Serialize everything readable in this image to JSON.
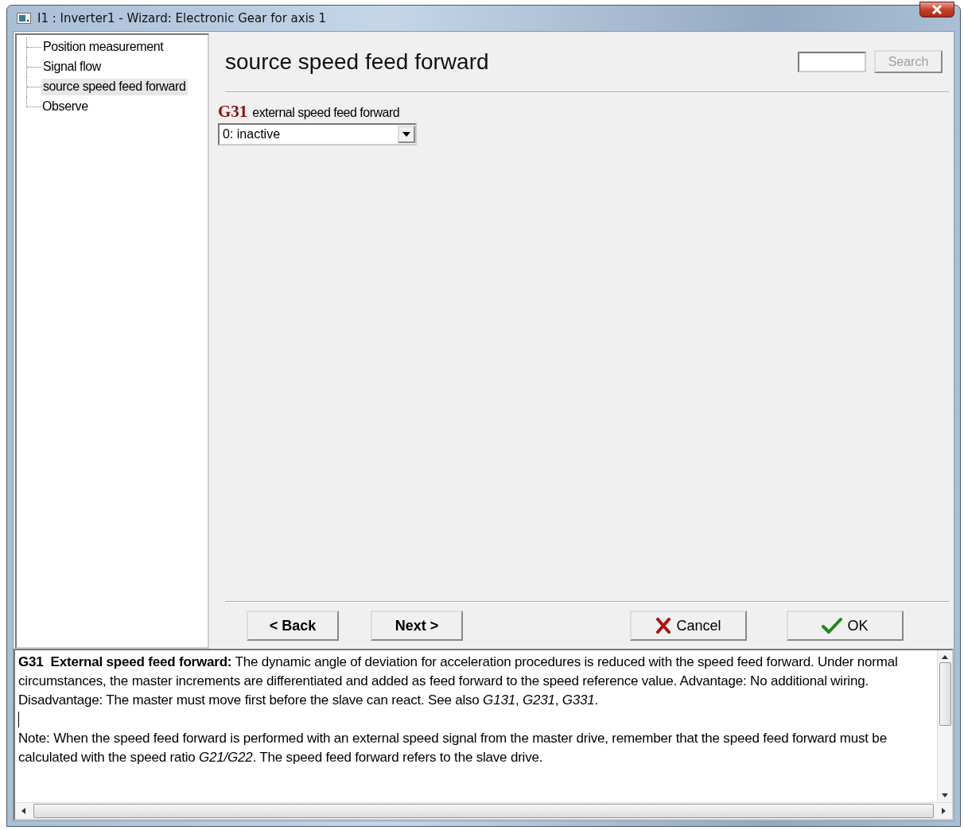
{
  "window": {
    "title": "I1 : Inverter1 - Wizard: Electronic Gear for axis 1"
  },
  "tree": {
    "items": [
      {
        "label": "Position measurement",
        "selected": false
      },
      {
        "label": "Signal flow",
        "selected": false
      },
      {
        "label": "source speed feed forward",
        "selected": true
      },
      {
        "label": "Observe",
        "selected": false
      }
    ]
  },
  "page": {
    "heading": "source speed feed forward",
    "search": {
      "button": "Search",
      "disabled": true
    },
    "parameter": {
      "code": "G31",
      "label": "external speed feed forward",
      "value": "0:  inactive"
    }
  },
  "buttons": [
    {
      "label": "< Back",
      "kind": "bold"
    },
    {
      "label": "Next >",
      "kind": "bold"
    },
    {
      "label": "Cancel",
      "kind": "cross"
    },
    {
      "label": "OK",
      "kind": "check"
    }
  ],
  "help": {
    "paragraphs": [
      "**G31  External speed feed forward:** The dynamic angle of deviation for acceleration procedures is reduced with the speed feed forward. Under normal circumstances, the master increments are differentiated and added as feed forward to the speed reference value. Advantage: No additional wiring. Disadvantage: The master must move first before the slave can react. See also *G131*, *G231*, *G331*.",
      "Note: When the speed feed forward is performed with an external speed signal from the master drive, remember that the speed feed forward must be calculated with the speed ratio *G21/G22*. The speed feed forward refers to the slave drive."
    ]
  }
}
